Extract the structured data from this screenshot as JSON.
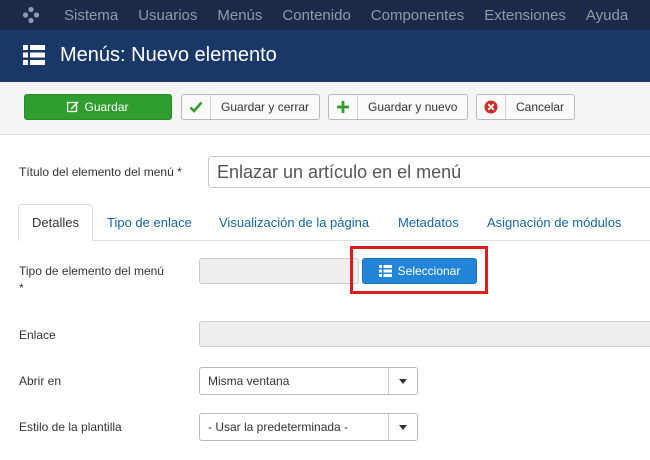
{
  "topnav": {
    "items": [
      "Sistema",
      "Usuarios",
      "Menús",
      "Contenido",
      "Componentes",
      "Extensiones",
      "Ayuda"
    ]
  },
  "header": {
    "title": "Menús: Nuevo elemento"
  },
  "toolbar": {
    "save": "Guardar",
    "save_close": "Guardar y cerrar",
    "save_new": "Guardar y nuevo",
    "cancel": "Cancelar"
  },
  "form": {
    "title_label": "Título del elemento del menú *",
    "title_value": "Enlazar un artículo en el menú",
    "tabs": [
      "Detalles",
      "Tipo de enlace",
      "Visualización de la página",
      "Metadatos",
      "Asignación de módulos"
    ],
    "item_type_label": "Tipo de elemento del menú *",
    "select_button": "Seleccionar",
    "link_label": "Enlace",
    "open_in_label": "Abrir en",
    "open_in_value": "Misma ventana",
    "template_style_label": "Estilo de la plantilla",
    "template_style_value": "- Usar la predeterminada -"
  },
  "colors": {
    "topnav_bg": "#1b2a47",
    "header_bg": "#1a3867",
    "save_green": "#2f9e2f",
    "select_blue": "#2385d7",
    "highlight_red": "#e01b1b"
  }
}
